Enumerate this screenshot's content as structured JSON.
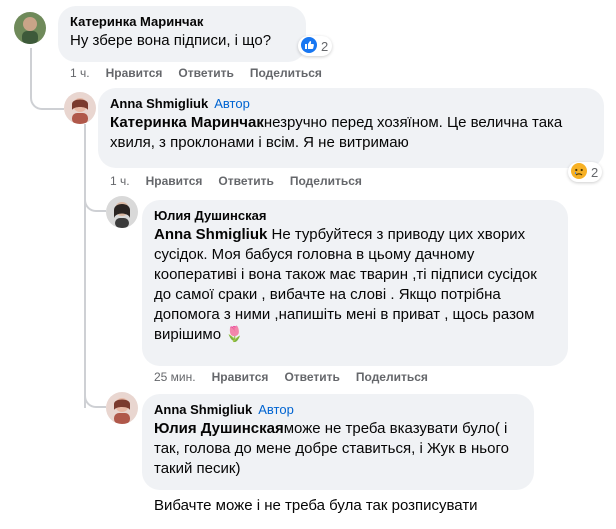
{
  "comments": [
    {
      "author": "Катеринка Маринчак",
      "text": "Ну збере вона підписи, і що?",
      "time": "1 ч.",
      "like": "Нравится",
      "reply": "Ответить",
      "share": "Поделиться",
      "reaction_count": "2",
      "reaction_icon": "like-icon"
    },
    {
      "author": "Anna Shmigliuk",
      "badge": "Автор",
      "mention": "Катеринка Маринчак",
      "text": "незручно перед хозяїном. Це велична така хвиля, з проклонами і всім. Я не витримаю",
      "time": "1 ч.",
      "like": "Нравится",
      "reply": "Ответить",
      "share": "Поделиться",
      "reaction_count": "2",
      "reaction_icon": "sad-icon"
    },
    {
      "author": "Юлия Душинская",
      "mention": "Anna Shmigliuk",
      "text": " Не турбуйтеся з приводу цих хворих сусідок. Моя бабуся головна в цьому дачному кооперативі і вона також має тварин ,ті підписи сусідок до самої сраки , вибачте на слові . Якщо потрібна допомога з ними ,напишіть мені в приват , щось разом вирішимо",
      "emoji": "🌷",
      "time": "25 мин.",
      "like": "Нравится",
      "reply": "Ответить",
      "share": "Поделиться"
    },
    {
      "author": "Anna Shmigliuk",
      "badge": "Автор",
      "mention": "Юлия Душинская",
      "text": "може не треба вказувати було( і так, голова до мене добре ставиться, і Жук в нього такий песик)",
      "extra": "Вибачте може і не треба була так розписувати"
    }
  ],
  "colors": {
    "bubble": "#f0f2f5",
    "secondary_text": "#65676b",
    "author_badge": "#0064d1",
    "like_blue": "#1877f2",
    "sad_yellow": "#f7b125"
  }
}
